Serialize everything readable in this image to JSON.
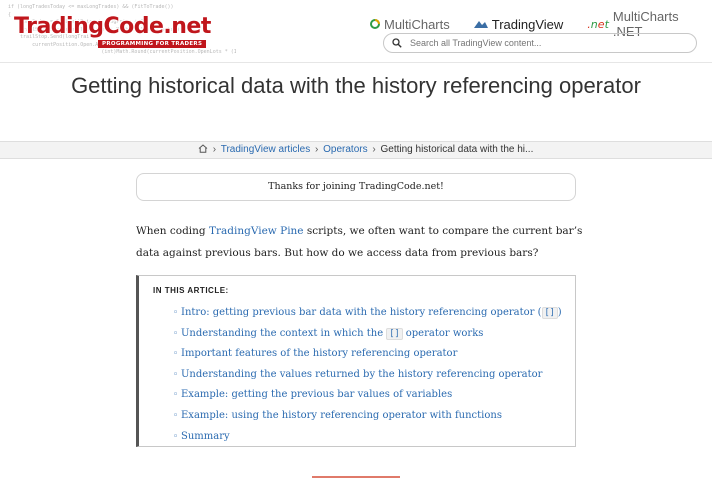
{
  "brand": {
    "name": "TradingCode.net",
    "tagline": "PROGRAMMING FOR TRADERS",
    "code_snippet": "if (longTradesToday <= maxLongTrades) && (FitToTrade())\n{\n    longOrder = SetLimitPrice + LongPrice + 1;\n    trailStop.SendOrder(longOrder + Math.Ceiling(inputs));\n    trailStop.Send(longTrail);\n        currentPosition.Open.Avg = 2 + ...\n                               (int)Math.Round(currentPosition.OpenLots * (1 - r));"
  },
  "nav": [
    {
      "label": "MultiCharts",
      "icon": "multicharts-icon"
    },
    {
      "label": "TradingView",
      "icon": "tradingview-icon"
    },
    {
      "label": "MultiCharts .NET",
      "icon": "dotnet-icon",
      "prefix": ".net"
    }
  ],
  "search": {
    "placeholder": "Search all TradingView content..."
  },
  "page": {
    "title": "Getting historical data with the history referencing operator"
  },
  "breadcrumb": {
    "items": [
      "TradingView articles",
      "Operators"
    ],
    "current": "Getting historical data with the hi..."
  },
  "notice": "Thanks for joining TradingCode.net!",
  "intro": {
    "before_link": "When coding ",
    "link": "TradingView Pine",
    "after_link": " scripts, we often want to compare the current bar’s data against previous bars. But how do we access data from previous bars?"
  },
  "toc": {
    "heading": "IN THIS ARTICLE:",
    "items": [
      {
        "text": "Intro: getting previous bar data with the history referencing operator (",
        "code": "[]",
        "tail": ")"
      },
      {
        "text": "Understanding the context in which the ",
        "code": "[]",
        "tail": " operator works"
      },
      {
        "text": "Important features of the history referencing operator"
      },
      {
        "text": "Understanding the values returned by the history referencing operator"
      },
      {
        "text": "Example: getting the previous bar values of variables"
      },
      {
        "text": "Example: using the history referencing operator with functions"
      },
      {
        "text": "Summary"
      }
    ]
  },
  "colors": {
    "brand_red": "#c0161c",
    "link_blue": "#2a6ab0",
    "divider": "#e07a6a"
  }
}
